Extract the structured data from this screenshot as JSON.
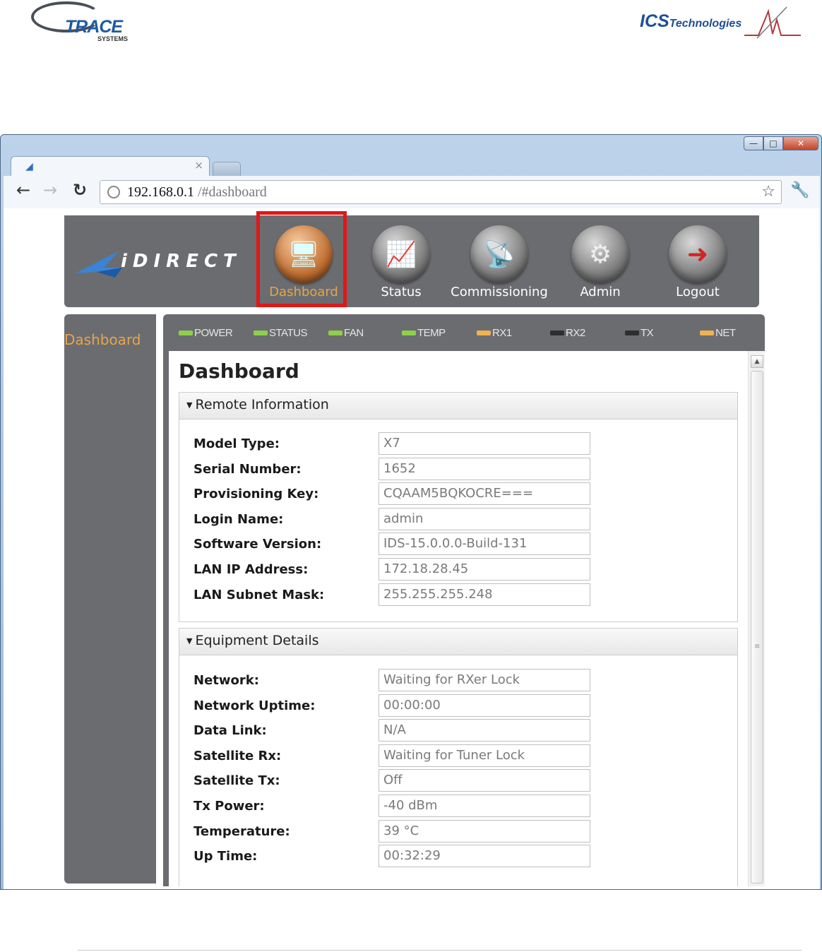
{
  "document": {
    "left_logo": {
      "word": "TRACE",
      "sub": "SYSTEMS"
    },
    "right_logo": {
      "word": "ICS",
      "tech": "Technologies"
    }
  },
  "window": {
    "controls": {
      "minimize": "—",
      "maximize": "□",
      "close": "✕"
    },
    "tab": {
      "title": "",
      "close": "×"
    }
  },
  "toolbar": {
    "url_host": "192.168.0.1",
    "url_path": " /#dashboard"
  },
  "app": {
    "brand": "iDIRECT",
    "nav": [
      {
        "label": "Dashboard",
        "icon": "monitor-icon",
        "active": true
      },
      {
        "label": "Status",
        "icon": "chart-icon",
        "active": false
      },
      {
        "label": "Commissioning",
        "icon": "satellite-dish-icon",
        "active": false
      },
      {
        "label": "Admin",
        "icon": "gear-icon",
        "active": false
      },
      {
        "label": "Logout",
        "icon": "exit-door-icon",
        "active": false
      }
    ],
    "sidebar": {
      "items": [
        {
          "label": "Dashboard"
        }
      ]
    },
    "leds": [
      {
        "label": "POWER",
        "color": "#8ed04a"
      },
      {
        "label": "STATUS",
        "color": "#8ed04a"
      },
      {
        "label": "FAN",
        "color": "#8ed04a"
      },
      {
        "label": "TEMP",
        "color": "#8ed04a"
      },
      {
        "label": "RX1",
        "color": "#f2b24f"
      },
      {
        "label": "RX2",
        "color": "#2e2e2e"
      },
      {
        "label": "TX",
        "color": "#2e2e2e"
      },
      {
        "label": "NET",
        "color": "#f2b24f"
      }
    ],
    "page_title": "Dashboard",
    "remote_information": {
      "title": "Remote Information",
      "rows": [
        {
          "label": "Model Type:",
          "value": "X7"
        },
        {
          "label": "Serial Number:",
          "value": "1652"
        },
        {
          "label": "Provisioning Key:",
          "value": "CQAAM5BQKOCRE==="
        },
        {
          "label": "Login Name:",
          "value": "admin"
        },
        {
          "label": "Software Version:",
          "value": "IDS-15.0.0.0-Build-131"
        },
        {
          "label": "LAN IP Address:",
          "value": "172.18.28.45"
        },
        {
          "label": "LAN Subnet Mask:",
          "value": "255.255.255.248"
        }
      ]
    },
    "equipment_details": {
      "title": "Equipment Details",
      "rows": [
        {
          "label": "Network:",
          "value": "Waiting for RXer Lock"
        },
        {
          "label": "Network Uptime:",
          "value": "00:00:00"
        },
        {
          "label": "Data Link:",
          "value": "N/A"
        },
        {
          "label": "Satellite Rx:",
          "value": "Waiting for Tuner Lock"
        },
        {
          "label": "Satellite Tx:",
          "value": "Off"
        },
        {
          "label": "Tx Power:",
          "value": "-40 dBm"
        },
        {
          "label": "Temperature:",
          "value": "39 °C"
        },
        {
          "label": "Up Time:",
          "value": "00:32:29"
        }
      ]
    }
  }
}
